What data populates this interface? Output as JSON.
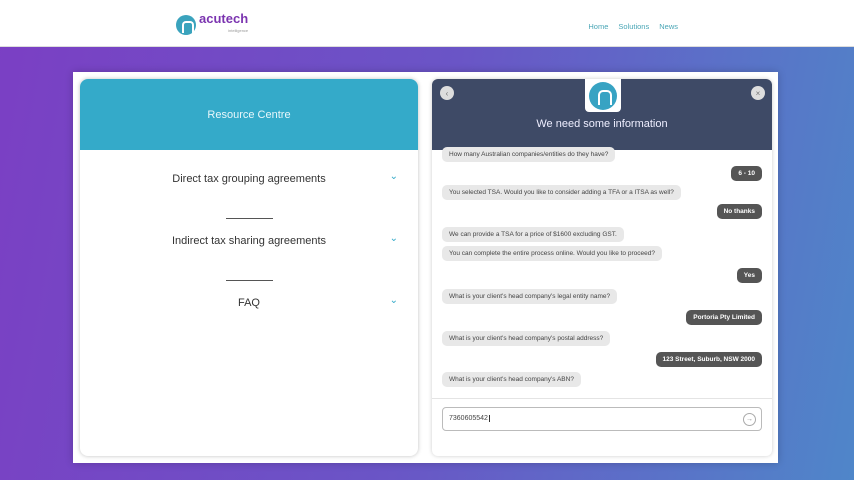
{
  "header": {
    "brand": "acutech",
    "tagline": "intelligence",
    "nav": [
      "Home",
      "Solutions",
      "News"
    ]
  },
  "resource": {
    "title": "Resource Centre",
    "items": [
      "Direct tax grouping agreements",
      "Indirect tax sharing agreements",
      "FAQ"
    ]
  },
  "chat": {
    "title": "We need some information",
    "messages": [
      {
        "from": "bot",
        "text": "How many Australian companies/entities do they have?"
      },
      {
        "from": "user",
        "text": "6 - 10"
      },
      {
        "from": "bot",
        "text": "You selected TSA. Would you like to consider adding a TFA or a ITSA as well?"
      },
      {
        "from": "user",
        "text": "No thanks"
      },
      {
        "from": "bot",
        "text": "We can provide a TSA for a price of $1600 excluding GST."
      },
      {
        "from": "bot",
        "text": "You can complete the entire process online. Would you like to proceed?"
      },
      {
        "from": "user",
        "text": "Yes"
      },
      {
        "from": "bot",
        "text": "What is your client's head company's legal entity name?"
      },
      {
        "from": "user",
        "text": "Portoria Pty Limited"
      },
      {
        "from": "bot",
        "text": "What is your client's head company's postal address?"
      },
      {
        "from": "user",
        "text": "123 Street, Suburb, NSW 2000"
      },
      {
        "from": "bot",
        "text": "What is your client's head company's ABN?"
      }
    ],
    "input_value": "7360605542"
  }
}
